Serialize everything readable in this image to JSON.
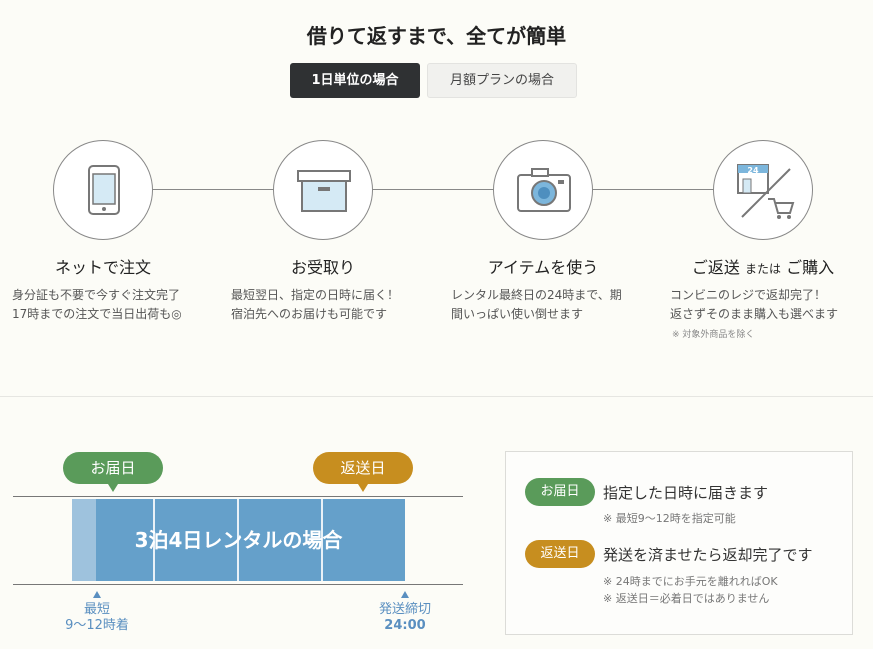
{
  "title": "借りて返すまで、全てが簡単",
  "tabs": [
    {
      "label": "1日単位の場合",
      "active": true
    },
    {
      "label": "月額プランの場合",
      "active": false
    }
  ],
  "steps": [
    {
      "icon": "smartphone-icon",
      "title": "ネットで注文",
      "desc1": "身分証も不要で今すぐ注文完了",
      "desc2": "17時までの注文で当日出荷も◎"
    },
    {
      "icon": "box-icon",
      "title": "お受取り",
      "desc1": "最短翌日、指定の日時に届く！",
      "desc2": "宿泊先へのお届けも可能です"
    },
    {
      "icon": "camera-icon",
      "title": "アイテムを使う",
      "desc1": "レンタル最終日の24時まで、期",
      "desc2": "間いっぱい使い倒せます"
    },
    {
      "icon": "convenience-store-icon",
      "title_a": "ご返送",
      "title_small": "または",
      "title_b": "ご購入",
      "desc1": "コンビニのレジで返却完了！",
      "desc2": "返さずそのまま購入も選べます",
      "note": "※ 対象外商品を除く"
    }
  ],
  "timeline": {
    "delivery_label": "お届日",
    "return_label": "返送日",
    "bar_text": "3泊4日レンタルの場合",
    "start_label1": "最短",
    "start_label2": "9〜12時着",
    "end_label1": "発送締切",
    "end_label2": "24:00"
  },
  "info": {
    "delivery_badge": "お届日",
    "delivery_text": "指定した日時に届きます",
    "delivery_note": "※ 最短9〜12時を指定可能",
    "return_badge": "返送日",
    "return_text": "発送を済ませたら返却完了です",
    "return_note1": "※ 24時までにお手元を離れればOK",
    "return_note2": "※ 返送日＝必着日ではありません"
  },
  "colors": {
    "green": "#5a9b5a",
    "gold": "#c78e1f",
    "blue": "#65a0ca"
  }
}
